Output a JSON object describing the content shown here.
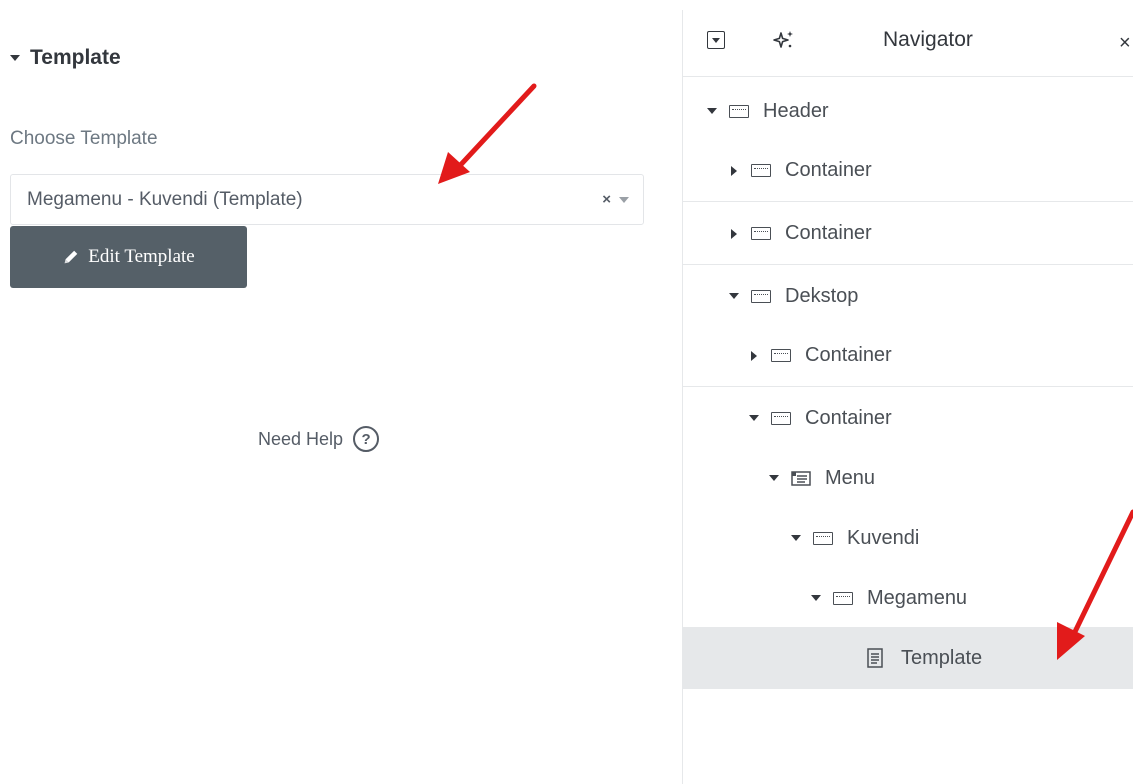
{
  "settings": {
    "section_title": "Template",
    "choose_label": "Choose Template",
    "select_value": "Megamenu - Kuvendi (Template)",
    "select_clear": "×",
    "edit_button": "Edit Template",
    "help_label": "Need Help",
    "help_icon_glyph": "?"
  },
  "navigator": {
    "title": "Navigator",
    "close_glyph": "×",
    "items": [
      {
        "label": "Header",
        "icon": "container-icon",
        "toggle": "expanded"
      },
      {
        "label": "Container",
        "icon": "container-icon",
        "toggle": "collapsed"
      },
      {
        "label": "Container",
        "icon": "container-icon",
        "toggle": "collapsed"
      },
      {
        "label": "Dekstop",
        "icon": "container-icon",
        "toggle": "expanded"
      },
      {
        "label": "Container",
        "icon": "container-icon",
        "toggle": "collapsed"
      },
      {
        "label": "Container",
        "icon": "container-icon",
        "toggle": "expanded"
      },
      {
        "label": "Menu",
        "icon": "menu-icon",
        "toggle": "expanded"
      },
      {
        "label": "Kuvendi",
        "icon": "container-icon",
        "toggle": "expanded"
      },
      {
        "label": "Megamenu",
        "icon": "container-icon",
        "toggle": "expanded"
      },
      {
        "label": "Template",
        "icon": "template-icon",
        "toggle": "none",
        "selected": true
      }
    ]
  },
  "colors": {
    "button_bg": "#556068",
    "selected_row_bg": "#e6e8ea",
    "annotation_arrow": "#e21b1b"
  }
}
